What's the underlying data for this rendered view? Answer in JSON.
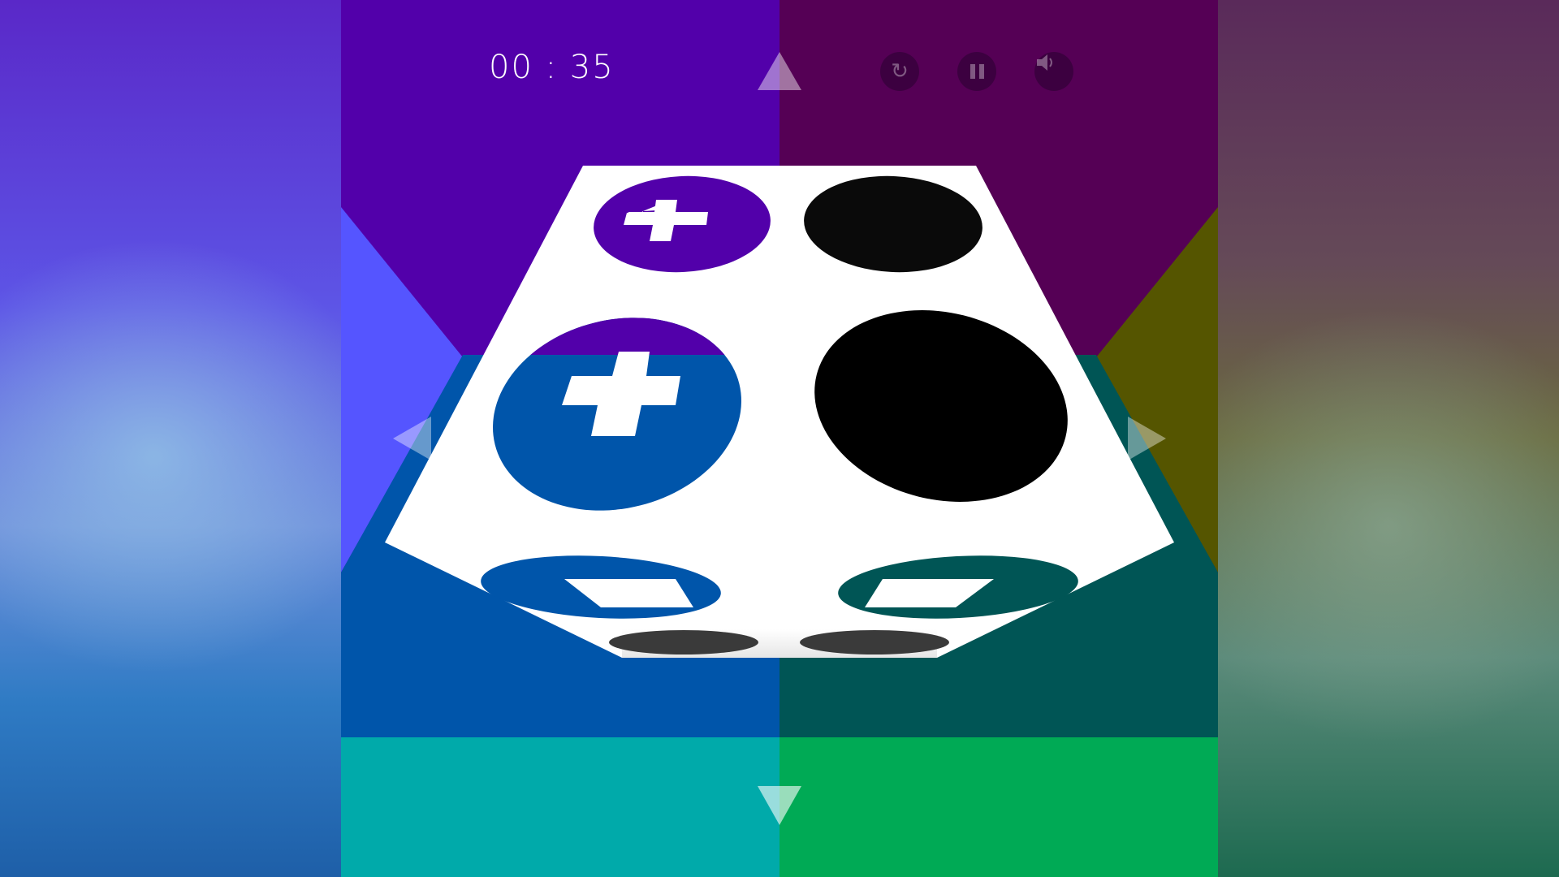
{
  "hud": {
    "timer": "00 : 35",
    "controls": [
      {
        "name": "restart",
        "icon": "refresh-icon"
      },
      {
        "name": "pause",
        "icon": "pause-icon"
      },
      {
        "name": "sound",
        "icon": "speaker-icon"
      }
    ]
  },
  "colors": {
    "top_left": "#5200aa",
    "top_right": "#550055",
    "left_wing": "#5555ff",
    "right_wing": "#555500",
    "mid_left": "#0055aa",
    "mid_right": "#005555",
    "bottom_left": "#00aaaa",
    "bottom_right": "#00aa55",
    "board": "#ffffff",
    "hole": "#000000"
  },
  "board": {
    "pieces": [
      {
        "name": "plus-piece-top",
        "symbol": "plus",
        "color": "#5200aa"
      },
      {
        "name": "plus-piece-middle",
        "symbol": "plus",
        "color": "#0055aa"
      },
      {
        "name": "minus-piece-blue",
        "symbol": "minus",
        "color": "#0055aa"
      },
      {
        "name": "minus-piece-teal",
        "symbol": "minus",
        "color": "#005555"
      }
    ],
    "holes": 4
  },
  "arrows": [
    "up",
    "down",
    "left",
    "right"
  ]
}
